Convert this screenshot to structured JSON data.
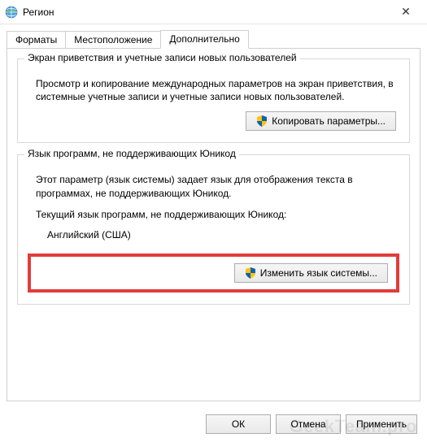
{
  "window": {
    "title": "Регион",
    "close_symbol": "✕"
  },
  "tabs": [
    {
      "label": "Форматы"
    },
    {
      "label": "Местоположение"
    },
    {
      "label": "Дополнительно"
    }
  ],
  "group1": {
    "legend": "Экран приветствия и учетные записи новых пользователей",
    "description": "Просмотр и копирование международных параметров на экран приветствия, в системные учетные записи и учетные записи новых пользователей.",
    "button": "Копировать параметры..."
  },
  "group2": {
    "legend": "Язык программ, не поддерживающих Юникод",
    "description": "Этот параметр (язык системы) задает язык для отображения текста в программах, не поддерживающих Юникод.",
    "current_label": "Текущий язык программ, не поддерживающих Юникод:",
    "current_value": "Английский (США)",
    "button": "Изменить язык системы..."
  },
  "footer": {
    "ok": "ОК",
    "cancel": "Отмена",
    "apply": "Применить"
  },
  "watermark": "GeekTeam.pro"
}
